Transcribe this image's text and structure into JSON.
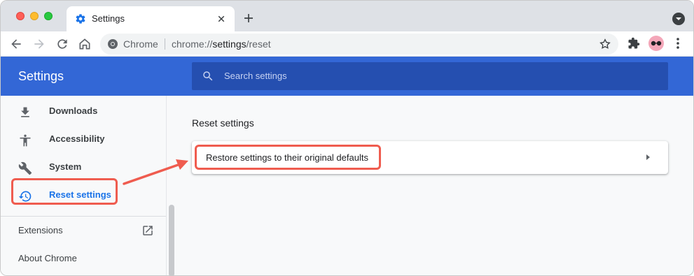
{
  "browser": {
    "tab_title": "Settings",
    "omnibox": {
      "site_label": "Chrome",
      "url_prefix": "chrome://",
      "url_strong": "settings",
      "url_suffix": "/reset"
    }
  },
  "header": {
    "title": "Settings",
    "search_placeholder": "Search settings"
  },
  "sidebar": {
    "items": [
      {
        "label": "Downloads",
        "icon": "download-icon"
      },
      {
        "label": "Accessibility",
        "icon": "accessibility-icon"
      },
      {
        "label": "System",
        "icon": "wrench-icon"
      },
      {
        "label": "Reset settings",
        "icon": "restore-icon",
        "active": true
      }
    ],
    "extensions_label": "Extensions",
    "about_label": "About Chrome"
  },
  "main": {
    "section_title": "Reset settings",
    "restore_label": "Restore settings to their original defaults"
  },
  "colors": {
    "header_blue": "#3367d6",
    "active_blue": "#1a73e8",
    "annotation_red": "#ef5c4f"
  }
}
